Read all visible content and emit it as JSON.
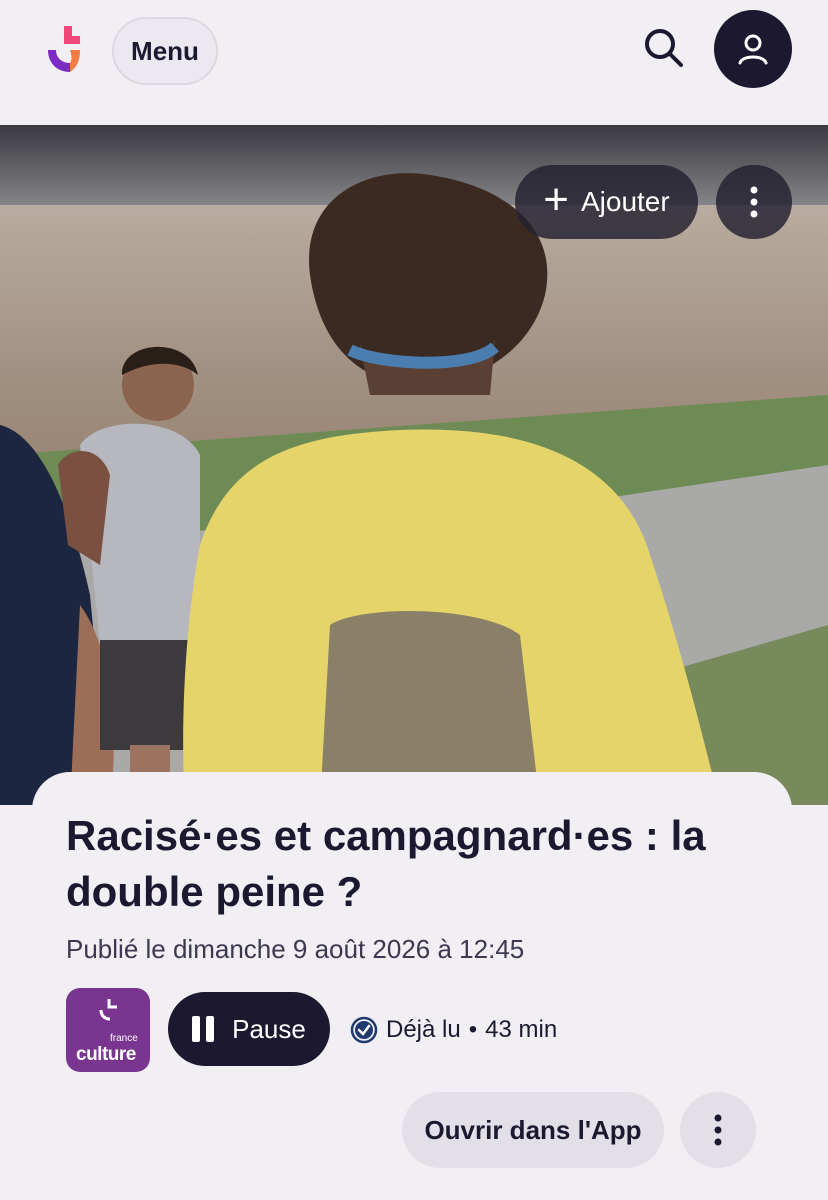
{
  "header": {
    "menu_label": "Menu",
    "logo_icon": "radio-france-logo-icon",
    "search_icon": "search-icon",
    "account_icon": "account-icon"
  },
  "hero": {
    "add_label": "Ajouter",
    "add_icon": "plus-icon",
    "more_icon": "more-vertical-icon"
  },
  "episode": {
    "title": "Racisé·es et campagnard·es : la double peine ?",
    "published": "Publié le dimanche 9 août 2026 à 12:45",
    "station_logo": {
      "line1": "france",
      "line2": "culture"
    },
    "pause_label": "Pause",
    "read_status": "Déjà lu",
    "duration": "43 min",
    "open_app_label": "Ouvrir dans l'App"
  },
  "colors": {
    "background": "#f1eef4",
    "dark": "#1b1830",
    "station_purple": "#7a3591"
  }
}
